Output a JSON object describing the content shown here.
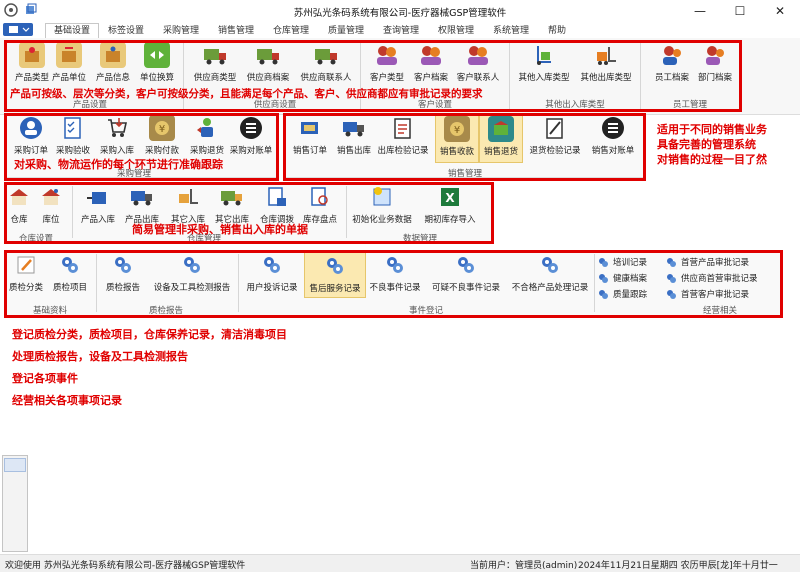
{
  "window": {
    "title": "苏州弘光条码系统有限公司-医疗器械GSP管理软件"
  },
  "menu": {
    "tabs": [
      "基础设置",
      "标签设置",
      "采购管理",
      "销售管理",
      "仓库管理",
      "质量管理",
      "查询管理",
      "权限管理",
      "系统管理",
      "帮助"
    ]
  },
  "ribbon": {
    "groups": {
      "product": "产品设置",
      "supplier": "供应商设置",
      "customer": "客户设置",
      "other": "其他出入库类型",
      "staff": "员工管理"
    },
    "buttons": {
      "product_type": "产品类型",
      "product_unit": "产品单位",
      "product_info": "产品信息",
      "unit_convert": "单位换算",
      "supplier_type": "供应商类型",
      "supplier_file": "供应商档案",
      "supplier_contact": "供应商联系人",
      "customer_type": "客户类型",
      "customer_file": "客户档案",
      "customer_contact": "客户联系人",
      "other_in_type": "其他入库类型",
      "other_out_type": "其他出库类型",
      "staff_file": "员工档案",
      "dept_file": "部门档案"
    }
  },
  "purchase": {
    "group": "采购管理",
    "buttons": [
      "采购订单",
      "采购验收",
      "采购入库",
      "采购付款",
      "采购退货",
      "采购对账单"
    ]
  },
  "sales": {
    "group": "销售管理",
    "buttons": [
      "销售订单",
      "销售出库",
      "出库检验记录",
      "销售收款",
      "销售退货",
      "退货检验记录",
      "销售对账单"
    ]
  },
  "warehouse": {
    "group_a": "仓库设置",
    "group_b": "仓库管理",
    "group_c": "数据管理",
    "buttons_a": [
      "仓库",
      "库位"
    ],
    "buttons_b": [
      "产品入库",
      "产品出库",
      "其它入库",
      "其它出库",
      "仓库调拨",
      "库存盘点"
    ],
    "buttons_c": [
      "初始化业务数据",
      "期初库存导入"
    ]
  },
  "quality": {
    "group_basic": "基础资料",
    "group_report": "质检报告",
    "group_event": "事件登记",
    "group_business": "经营相关",
    "basic": [
      "质检分类",
      "质检项目"
    ],
    "report": [
      "质检报告",
      "设备及工具检测报告"
    ],
    "event": [
      "用户投诉记录",
      "售后服务记录",
      "不良事件记录",
      "可疑不良事件记录",
      "不合格产品处理记录"
    ],
    "list_a": [
      "培训记录",
      "健康档案",
      "质量跟踪"
    ],
    "list_b": [
      "首营产品审批记录",
      "供应商首营审批记录",
      "首营客户审批记录"
    ]
  },
  "annotations": {
    "ribbon": "产品可按级、层次等分类，客户可按级分类，且能满足每个产品、客户、供应商都应有审批记录的要求",
    "purchase": "对采购、物流运作的每个环节进行准确跟踪",
    "sales_line1": "适用于不同的销售业务",
    "sales_line2": "具备完善的管理系统",
    "sales_line3": "对销售的过程一目了然",
    "warehouse": "简易管理非采购、销售出入库的单据",
    "quality_1": "登记质检分类，质检项目，仓库保养记录，清洁消毒项目",
    "quality_2": "处理质检报告，设备及工具检测报告",
    "quality_3": "登记各项事件",
    "quality_4": "经营相关各项事项记录"
  },
  "status": {
    "welcome": "欢迎使用 苏州弘光条码系统有限公司-医疗器械GSP管理软件",
    "user": "当前用户：管理员(admin)",
    "date": "2024年11月21日星期四 农历甲辰[龙]年十月廿一"
  },
  "colors": {
    "accent": "#2c62b8",
    "annotation": "#e00000",
    "highlight": "#fbe9b1"
  }
}
